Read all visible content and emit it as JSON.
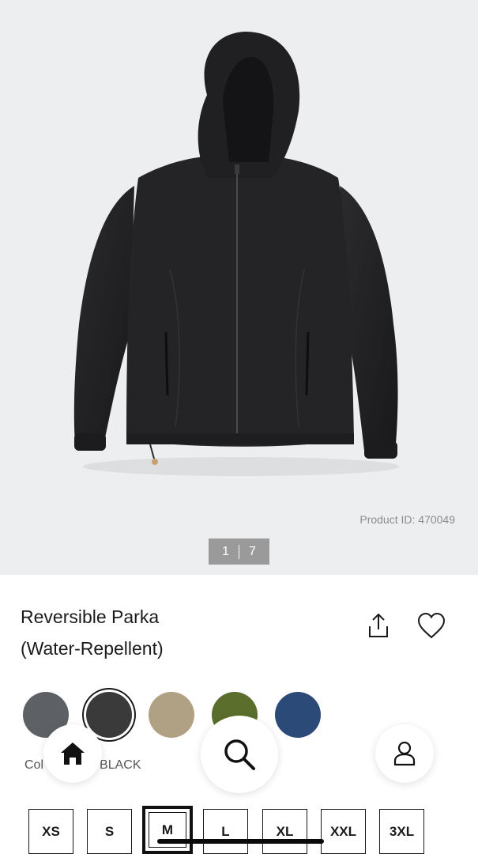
{
  "gallery": {
    "product_id_text": "Product ID: 470049",
    "current_image": "1",
    "total_images": "7",
    "image_subject": "jacket"
  },
  "product": {
    "title_line1": "Reversible Parka",
    "title_line2": "(Water-Repellent)"
  },
  "actions": {
    "share_icon": "share-icon",
    "favorite_icon": "heart-icon"
  },
  "colors": {
    "label_visible": "Col",
    "selected_name": "BLACK",
    "swatches": [
      {
        "name": "gray",
        "hex": "#5d6064"
      },
      {
        "name": "black",
        "hex": "#3a3a3a",
        "selected": true
      },
      {
        "name": "beige",
        "hex": "#b0a084"
      },
      {
        "name": "olive",
        "hex": "#5b6e2c"
      },
      {
        "name": "navy",
        "hex": "#2c4a78"
      }
    ]
  },
  "nav": {
    "home_icon": "home-icon",
    "search_icon": "search-icon",
    "account_icon": "user-icon"
  },
  "sizes": {
    "options": [
      "XS",
      "S",
      "M",
      "L",
      "XL",
      "XXL",
      "3XL"
    ],
    "selected": "M"
  }
}
